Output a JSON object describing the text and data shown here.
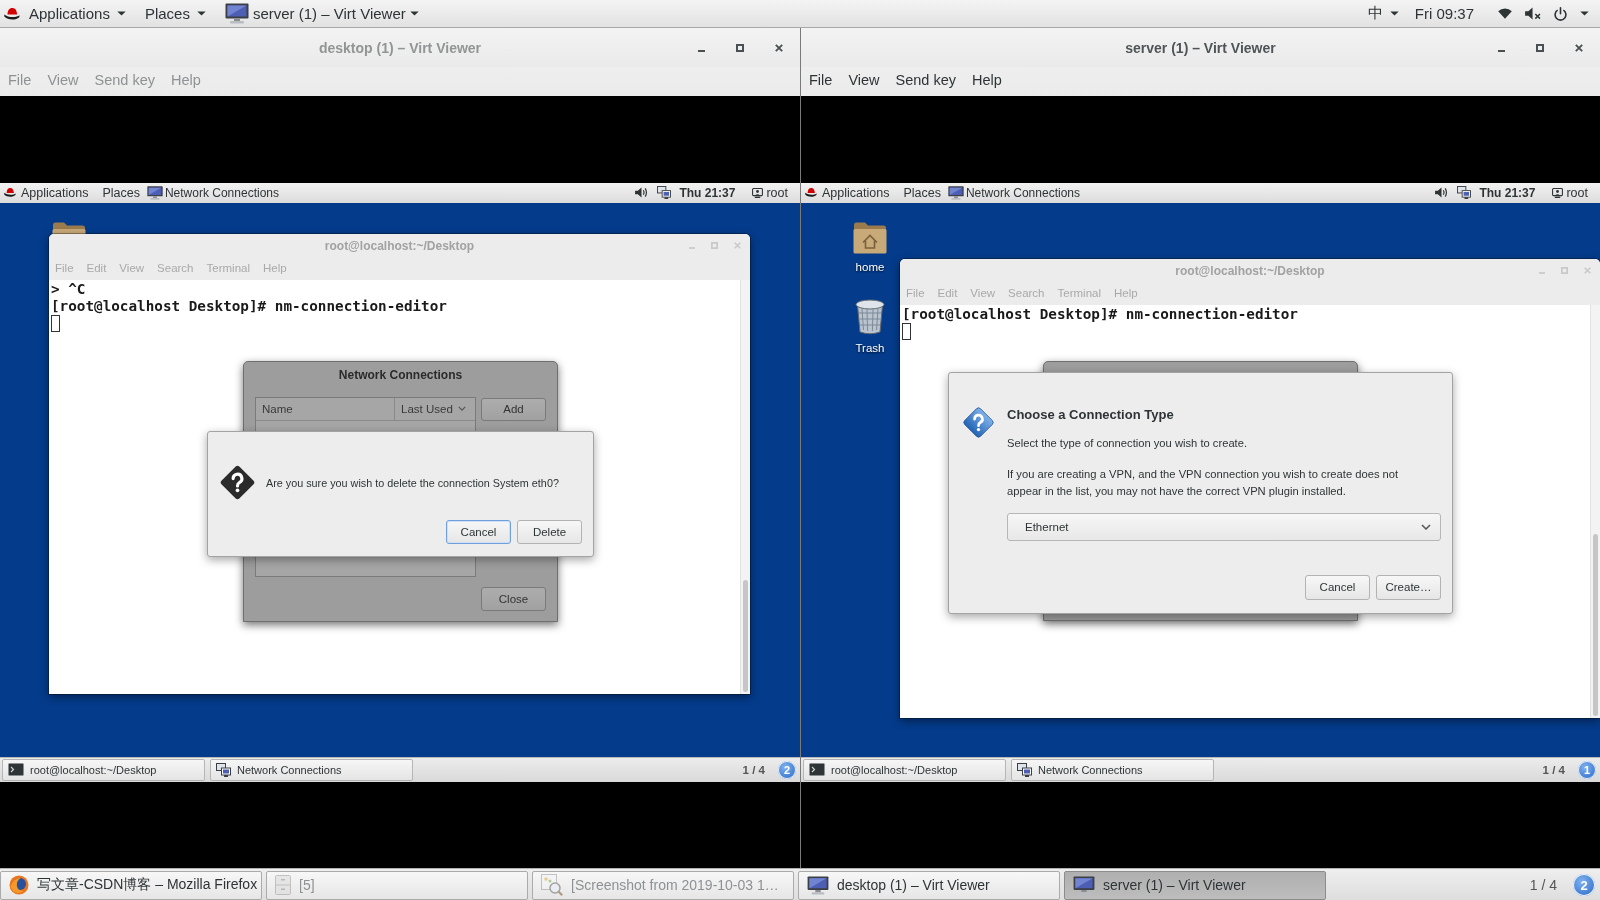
{
  "top_bar": {
    "menus": [
      {
        "kind": "applications",
        "label": "Applications"
      },
      {
        "kind": "places",
        "label": "Places"
      },
      {
        "kind": "window",
        "label": "server (1) – Virt Viewer"
      }
    ],
    "input_method": "中",
    "clock": "Fri 09:37"
  },
  "viewers": [
    {
      "title": "desktop (1) – Virt Viewer",
      "focused": false,
      "menu": [
        "File",
        "View",
        "Send key",
        "Help"
      ],
      "guest": {
        "top_bar": {
          "applications": "Applications",
          "places": "Places",
          "window": "Network Connections",
          "clock": "Thu 21:37",
          "user": "root"
        },
        "desktop_icons": [
          {
            "kind": "home"
          }
        ],
        "terminal": {
          "title": "root@localhost:~/Desktop",
          "focused": false,
          "menu": [
            "File",
            "Edit",
            "View",
            "Search",
            "Terminal",
            "Help"
          ],
          "lines": [
            "> ^C",
            "[root@localhost Desktop]# nm-connection-editor"
          ]
        },
        "parent_dialog": {
          "kind": "list",
          "title": "Network Connections",
          "columns": [
            "Name",
            "Last Used"
          ],
          "buttons": [
            "Add",
            "Close"
          ]
        },
        "dialog": {
          "kind": "confirm",
          "message": "Are you sure you wish to delete the connection System eth0?",
          "buttons": [
            {
              "label": "Cancel",
              "default": true
            },
            {
              "label": "Delete",
              "default": false
            }
          ]
        },
        "taskbar": {
          "windows": [
            {
              "kind": "terminal",
              "label": "root@localhost:~/Desktop"
            },
            {
              "kind": "network",
              "label": "Network Connections"
            }
          ],
          "workspace": "1 / 4",
          "workspace_badge": "2"
        }
      }
    },
    {
      "title": "server (1) – Virt Viewer",
      "focused": true,
      "menu": [
        "File",
        "View",
        "Send key",
        "Help"
      ],
      "guest": {
        "top_bar": {
          "applications": "Applications",
          "places": "Places",
          "window": "Network Connections",
          "clock": "Thu 21:37",
          "user": "root"
        },
        "desktop_icons": [
          {
            "kind": "home",
            "label": "home"
          },
          {
            "kind": "trash",
            "label": "Trash"
          }
        ],
        "terminal": {
          "title": "root@localhost:~/Desktop",
          "focused": false,
          "menu": [
            "File",
            "Edit",
            "View",
            "Search",
            "Terminal",
            "Help"
          ],
          "lines": [
            "[root@localhost Desktop]# nm-connection-editor"
          ]
        },
        "parent_dialog": {
          "kind": "frame"
        },
        "dialog": {
          "kind": "choose",
          "heading": "Choose a Connection Type",
          "text": "Select the type of connection you wish to create.",
          "note": "If you are creating a VPN, and the VPN connection you wish to create does not appear in the list, you may not have the correct VPN plugin installed.",
          "selection": "Ethernet",
          "buttons": [
            {
              "label": "Cancel",
              "default": false
            },
            {
              "label": "Create…",
              "default": false
            }
          ]
        },
        "taskbar": {
          "windows": [
            {
              "kind": "terminal",
              "label": "root@localhost:~/Desktop"
            },
            {
              "kind": "network",
              "label": "Network Connections"
            }
          ],
          "workspace": "1 / 4",
          "workspace_badge": "1"
        }
      }
    }
  ],
  "taskbar": {
    "windows": [
      {
        "kind": "browser",
        "label": "写文章-CSDN博客 – Mozilla Firefox",
        "minimized": false,
        "selected": false
      },
      {
        "kind": "files",
        "label": "[5]",
        "minimized": true,
        "selected": false
      },
      {
        "kind": "image",
        "label": "[Screenshot from 2019-10-03 1…",
        "minimized": true,
        "selected": false
      },
      {
        "kind": "viewer",
        "label": "desktop (1) – Virt Viewer",
        "minimized": false,
        "selected": false
      },
      {
        "kind": "viewer",
        "label": "server (1) – Virt Viewer",
        "minimized": false,
        "selected": true
      }
    ],
    "workspace": "1 / 4",
    "workspace_badge": "2"
  }
}
